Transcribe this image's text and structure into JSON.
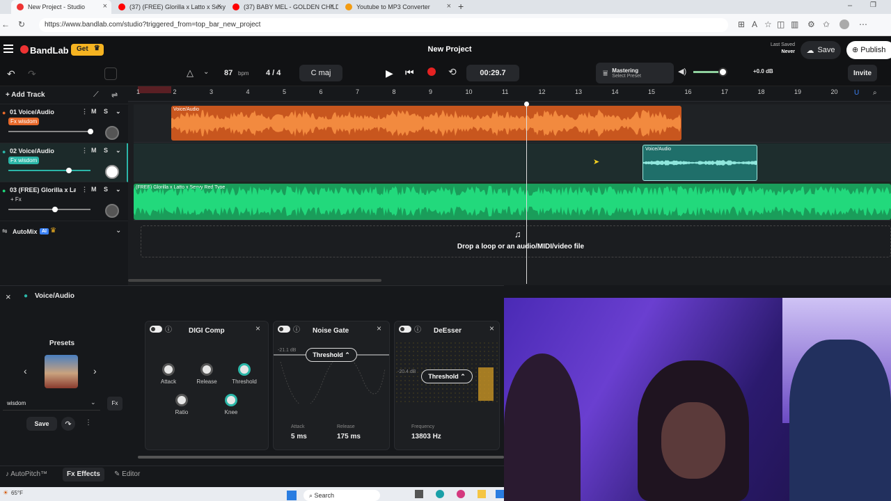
{
  "browser": {
    "tabs": [
      {
        "title": "New Project - Studio"
      },
      {
        "title": "(37) (FREE) Glorilla x Latto x Sexyy"
      },
      {
        "title": "(37) BABY MEL - GOLDEN CHILD (("
      },
      {
        "title": "Youtube to MP3 Converter"
      }
    ],
    "new_tab": "+",
    "url": "https://www.bandlab.com/studio?triggered_from=top_bar_new_project"
  },
  "app": {
    "logo": "BandLab",
    "get_label": "Get",
    "project_title": "New Project",
    "last_saved_label": "Last Saved",
    "last_saved_value": "Never",
    "save_label": "Save",
    "publish_label": "Publish",
    "invite_label": "Invite"
  },
  "toolbar": {
    "bpm_value": "87",
    "bpm_unit": "bpm",
    "time_signature": "4 / 4",
    "key": "C maj",
    "time": "00:29.7",
    "mastering_label": "Mastering",
    "mastering_sub": "Select Preset",
    "gain": "+0.0 dB"
  },
  "tracks": {
    "add_track": "Add Track",
    "items": [
      {
        "name": "01  Voice/Audio",
        "fx": "Fx wisdom",
        "color": "#e8692a",
        "vol": 0.9
      },
      {
        "name": "02  Voice/Audio",
        "fx": "Fx wisdom",
        "color": "#2bb6a8",
        "vol": 0.67
      },
      {
        "name": "03  (FREE) Glorilla x La...",
        "fx": "+ Fx",
        "color": "#1fd67a",
        "vol": 0.53
      }
    ],
    "m_label": "M",
    "s_label": "S",
    "automix": "AutoMix",
    "ai_badge": "AI"
  },
  "ruler": {
    "marks": [
      "1",
      "2",
      "3",
      "4",
      "5",
      "6",
      "7",
      "8",
      "9",
      "10",
      "11",
      "12",
      "13",
      "14",
      "15",
      "16",
      "17",
      "18",
      "19",
      "20"
    ]
  },
  "clips": {
    "clip1": "Voice/Audio",
    "clip2": "Voice/Audio",
    "clip3": "(FREE) Glorilla x Latto x Sexyy Red Type"
  },
  "drop_text": "Drop a loop or an audio/MIDI/video file",
  "fx_panel": {
    "track_name": "Voice/Audio",
    "presets_title": "Presets",
    "preset_name": "wisdom",
    "save_label": "Save",
    "effects": {
      "digi": {
        "title": "DIGI Comp",
        "knobs": [
          "Attack",
          "Release",
          "Threshold",
          "Ratio",
          "Knee"
        ]
      },
      "gate": {
        "title": "Noise Gate",
        "threshold_btn": "Threshold",
        "db": "-21.1 dB",
        "attack_label": "Attack",
        "attack_val": "5 ms",
        "release_label": "Release",
        "release_val": "175 ms"
      },
      "deesser": {
        "title": "DeEsser",
        "threshold_btn": "Threshold",
        "db": "-20.4 dB",
        "freq_label": "Frequency",
        "freq_val": "13803 Hz"
      }
    },
    "bottom_tabs": [
      "AutoPitch™",
      "Effects",
      "Editor"
    ]
  },
  "taskbar": {
    "weather": "65°F",
    "search": "Search"
  }
}
